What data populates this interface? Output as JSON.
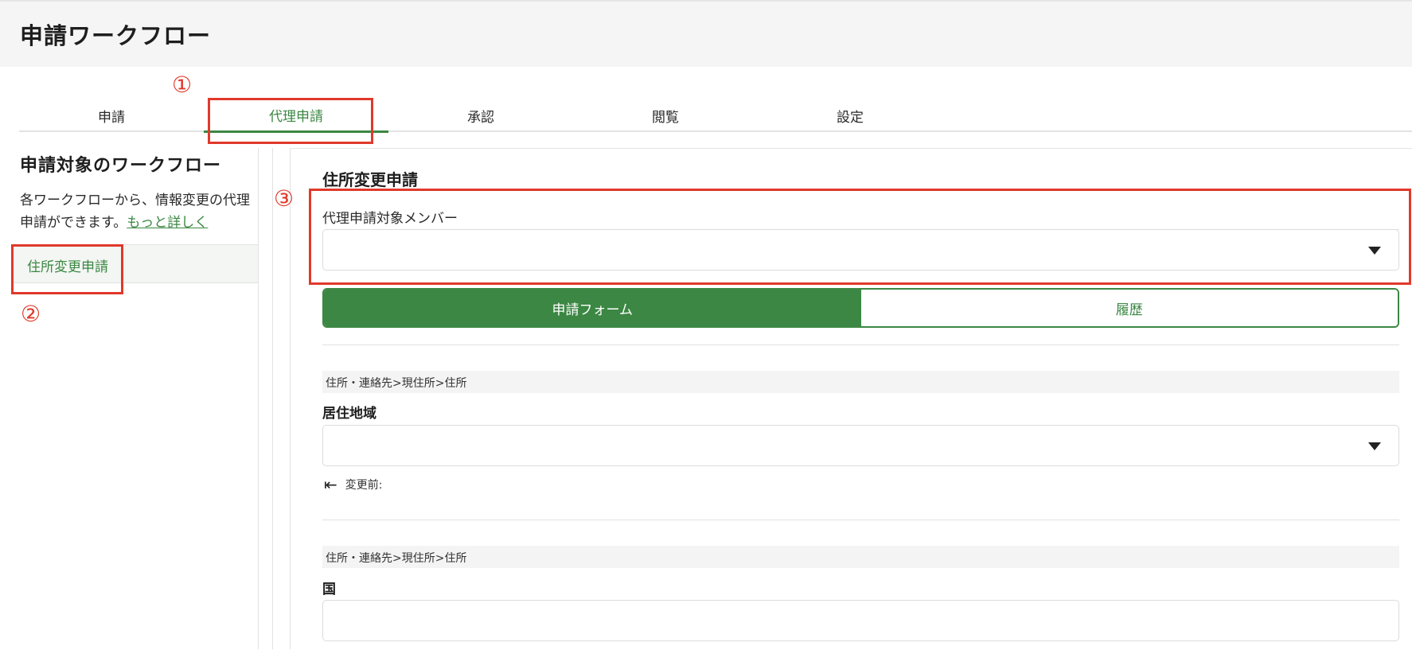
{
  "header": {
    "title": "申請ワークフロー"
  },
  "tabs": [
    {
      "label": "申請",
      "active": false
    },
    {
      "label": "代理申請",
      "active": true
    },
    {
      "label": "承認",
      "active": false
    },
    {
      "label": "閲覧",
      "active": false
    },
    {
      "label": "設定",
      "active": false
    }
  ],
  "sidebar": {
    "title": "申請対象のワークフロー",
    "description": "各ワークフローから、情報変更の代理申請ができます。",
    "more_link": "もっと詳しく",
    "items": [
      {
        "label": "住所変更申請",
        "selected": true
      }
    ]
  },
  "main": {
    "title": "住所変更申請",
    "proxy_member": {
      "label": "代理申請対象メンバー",
      "value": ""
    },
    "segments": [
      {
        "label": "申請フォーム",
        "active": true
      },
      {
        "label": "履歴",
        "active": false
      }
    ],
    "fields": [
      {
        "path": "住所・連絡先>現住所>住所",
        "label": "居住地域",
        "type": "select",
        "value": "",
        "before_label": "変更前:"
      },
      {
        "path": "住所・連絡先>現住所>住所",
        "label": "国",
        "type": "text",
        "value": ""
      }
    ]
  },
  "annotations": [
    "①",
    "②",
    "③"
  ],
  "colors": {
    "accent": "#3b8743",
    "annotation": "#e0392b",
    "header_bg": "#f5f5f5"
  },
  "icons": {
    "dropdown": "caret-down-icon",
    "before": "arrow-left-bar-icon"
  }
}
